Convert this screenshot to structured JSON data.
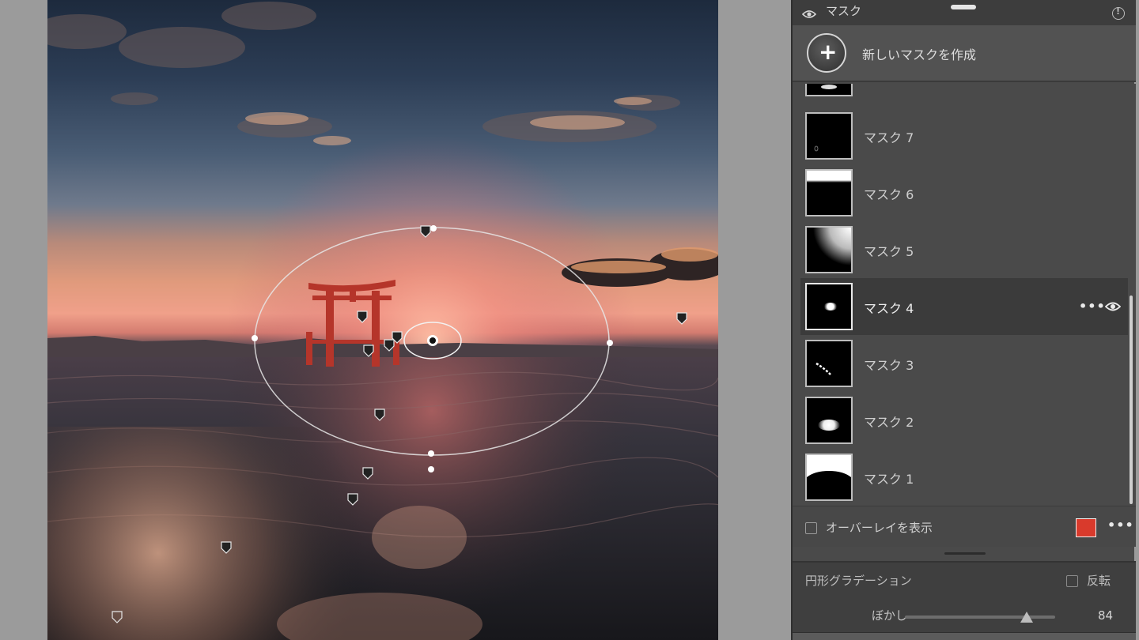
{
  "panel": {
    "title": "マスク",
    "new_mask_label": "新しいマスクを作成",
    "masks": [
      {
        "name": "",
        "thumb": "partial",
        "selected": false
      },
      {
        "name": "マスク 7",
        "thumb": "dark-speck",
        "selected": false
      },
      {
        "name": "マスク 6",
        "thumb": "top-white",
        "selected": false
      },
      {
        "name": "マスク 5",
        "thumb": "corner-gradient",
        "selected": false
      },
      {
        "name": "マスク 4",
        "thumb": "small-ellipse",
        "selected": true
      },
      {
        "name": "マスク 3",
        "thumb": "diagonal-streak",
        "selected": false
      },
      {
        "name": "マスク 2",
        "thumb": "ellipse",
        "selected": false
      },
      {
        "name": "マスク 1",
        "thumb": "top-arc",
        "selected": false
      }
    ],
    "overlay_label": "オーバーレイを表示",
    "overlay_checked": false,
    "overlay_color": "#d93a2c",
    "more_label": "•••",
    "gradient_title": "円形グラデーション",
    "invert_label": "反転",
    "invert_checked": false,
    "feather_label": "ぼかし",
    "feather_value": "84",
    "feather_fraction": 0.81
  }
}
